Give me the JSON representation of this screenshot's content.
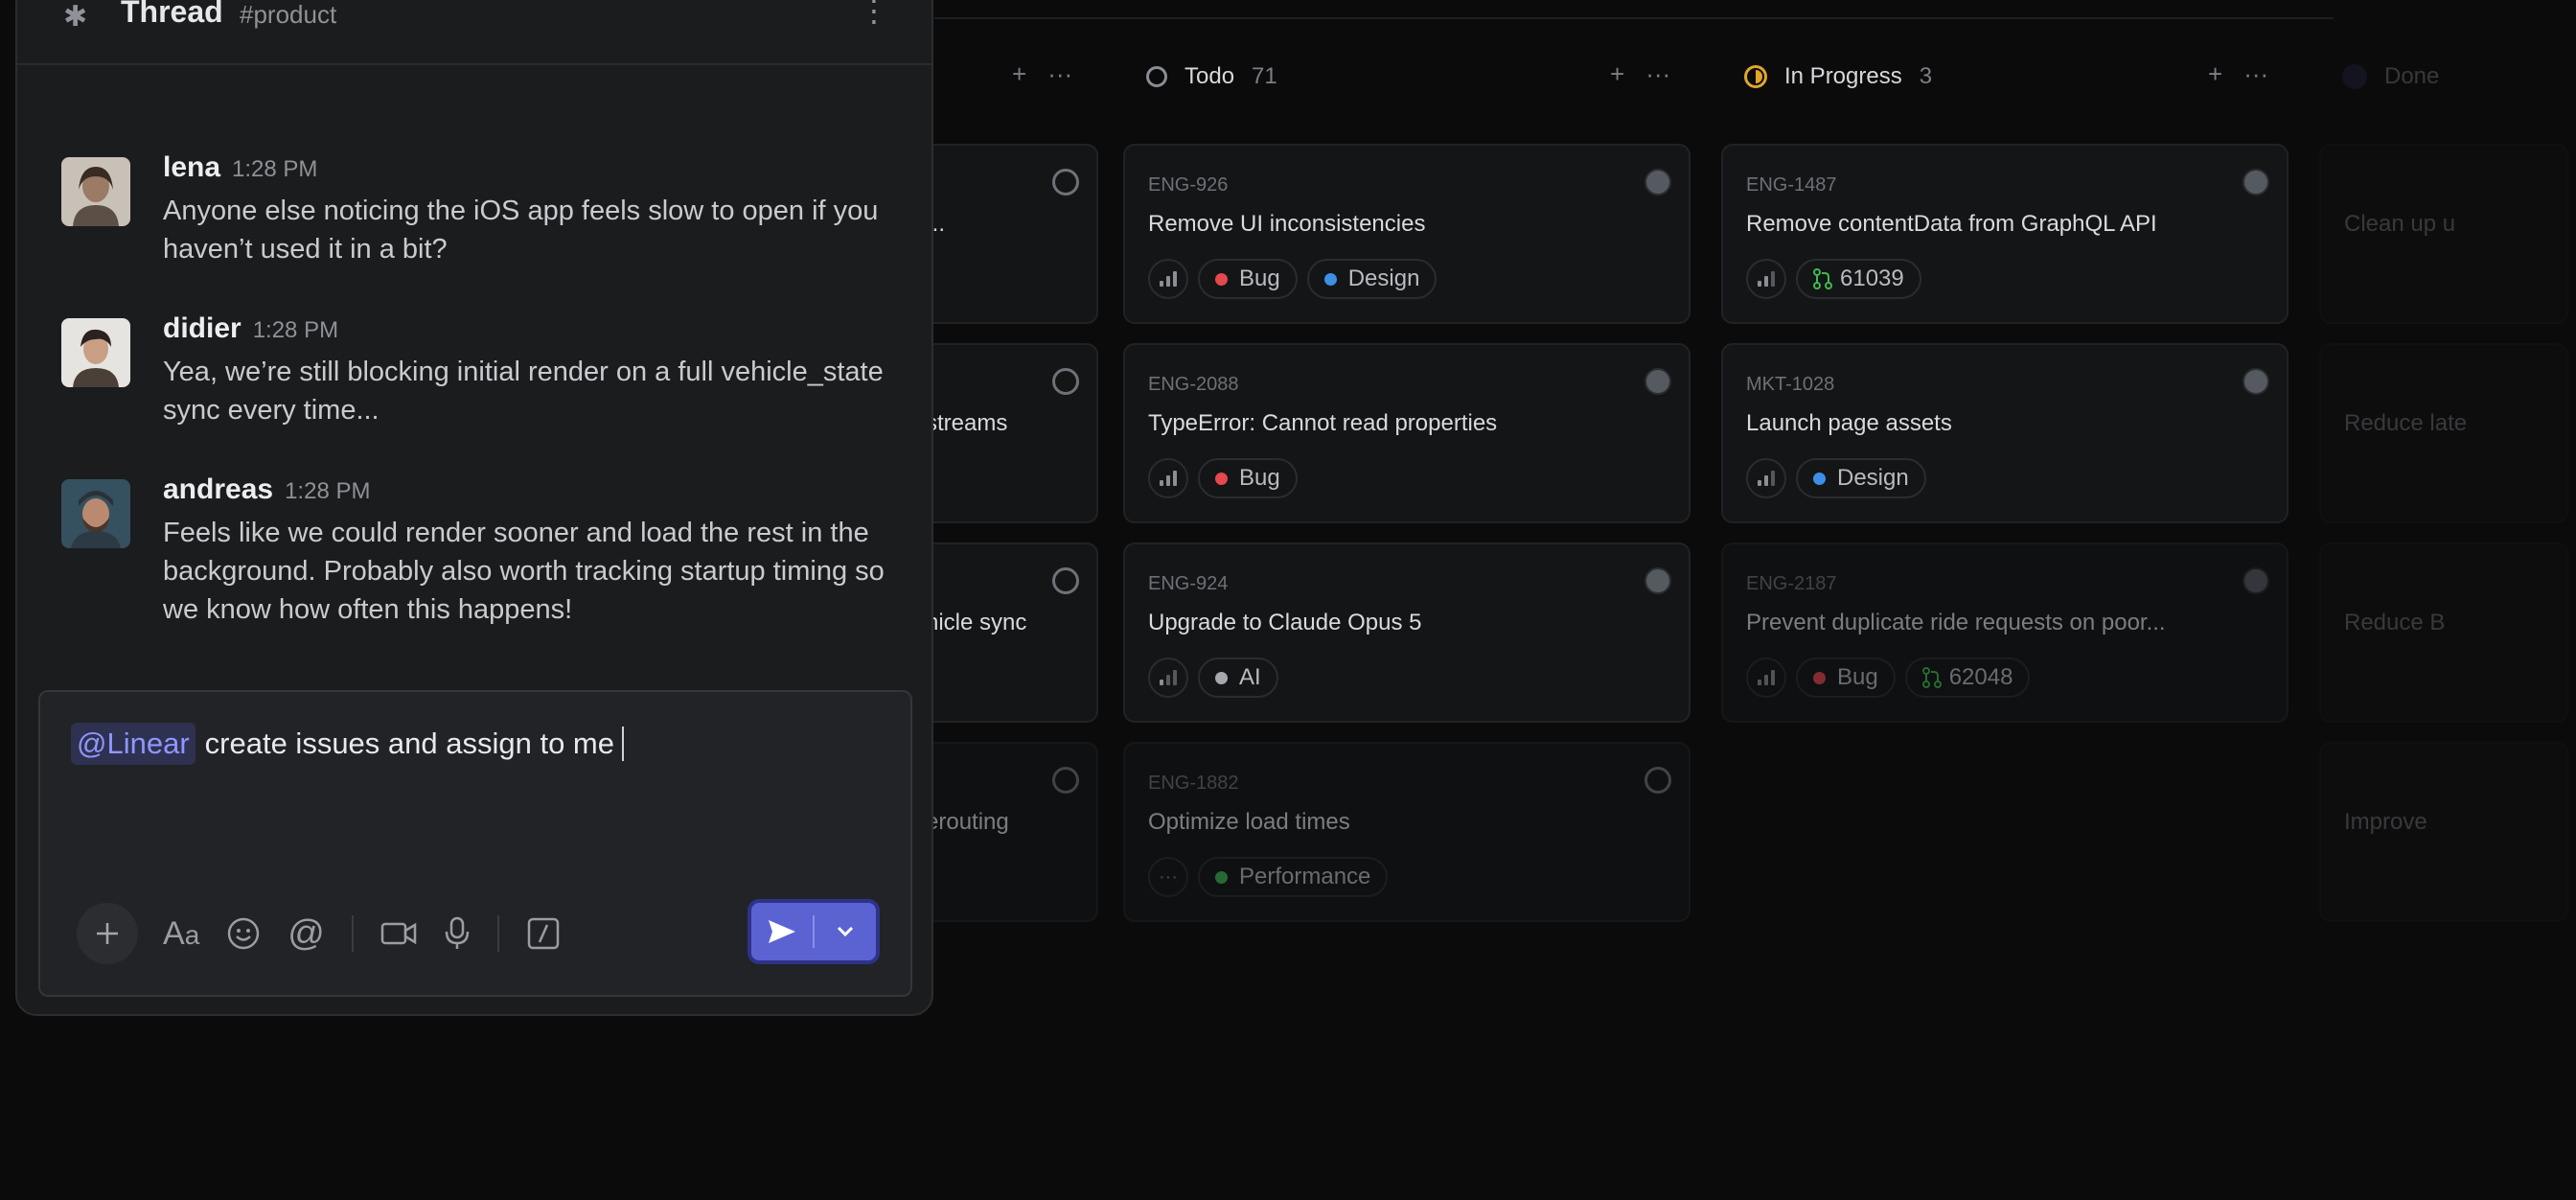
{
  "board": {
    "columns": [
      {
        "key": "todo",
        "title": "Todo",
        "count": "71"
      },
      {
        "key": "progress",
        "title": "In Progress",
        "count": "3"
      },
      {
        "key": "done",
        "title": "Done",
        "count": ""
      }
    ],
    "left_partial_cards": [
      {
        "title_fragment": "..."
      },
      {
        "title_fragment": "streams"
      },
      {
        "title_fragment": "hicle sync"
      },
      {
        "title_fragment": "erouting"
      }
    ],
    "todo_cards": [
      {
        "id": "ENG-926",
        "title": "Remove UI inconsistencies",
        "labels": [
          {
            "name": "Bug",
            "color": "#e5484d"
          },
          {
            "name": "Design",
            "color": "#3e8ee6"
          }
        ]
      },
      {
        "id": "ENG-2088",
        "title": "TypeError: Cannot read properties",
        "labels": [
          {
            "name": "Bug",
            "color": "#e5484d"
          }
        ]
      },
      {
        "id": "ENG-924",
        "title": "Upgrade to Claude Opus 5",
        "labels": [
          {
            "name": "AI",
            "color": "#a5a8ad"
          }
        ]
      },
      {
        "id": "ENG-1882",
        "title": "Optimize load times",
        "labels": [
          {
            "name": "Performance",
            "color": "#3fb950"
          }
        ]
      }
    ],
    "progress_cards": [
      {
        "id": "ENG-1487",
        "title": "Remove contentData from GraphQL API",
        "pr": "61039"
      },
      {
        "id": "MKT-1028",
        "title": "Launch page assets",
        "labels": [
          {
            "name": "Design",
            "color": "#3e8ee6"
          }
        ]
      },
      {
        "id": "ENG-2187",
        "title": "Prevent duplicate ride requests on poor...",
        "labels": [
          {
            "name": "Bug",
            "color": "#e5484d"
          }
        ],
        "pr": "62048"
      }
    ],
    "done_partial_cards": [
      {
        "title_fragment": "Clean up u"
      },
      {
        "title_fragment": "Reduce late"
      },
      {
        "title_fragment": "Reduce B"
      },
      {
        "title_fragment": "Improve"
      }
    ]
  },
  "thread": {
    "title": "Thread",
    "channel": "#product",
    "messages": [
      {
        "author": "lena",
        "time": "1:28 PM",
        "text": "Anyone else noticing the iOS app feels slow to open if you haven’t used it in a bit?"
      },
      {
        "author": "didier",
        "time": "1:28 PM",
        "text": "Yea, we’re still blocking initial render on a full vehicle_state sync every time..."
      },
      {
        "author": "andreas",
        "time": "1:28 PM",
        "text": "Feels like we could render sooner and load the rest in the background. Probably also worth tracking startup timing so we know how often this happens!"
      }
    ],
    "composer": {
      "mention": "@Linear",
      "text": "create issues and assign to me"
    }
  },
  "colors": {
    "accent": "#5b63d3",
    "mention_text": "#8e97ff",
    "in_progress": "#e2a52a"
  }
}
